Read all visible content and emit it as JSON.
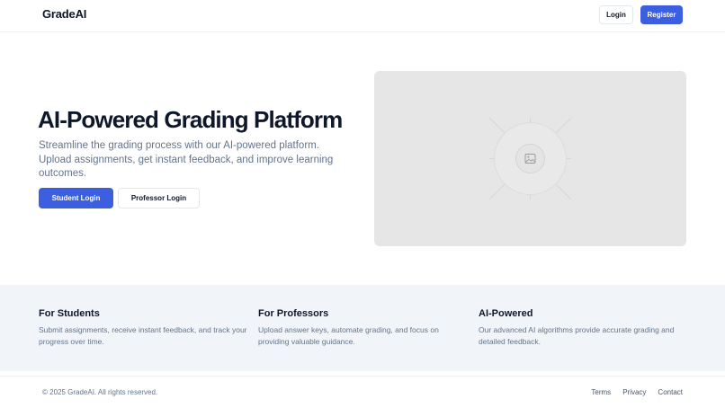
{
  "header": {
    "logo": "GradeAI",
    "login_label": "Login",
    "register_label": "Register"
  },
  "hero": {
    "title": "AI-Powered Grading Platform",
    "description": "Streamline the grading process with our AI-powered platform. Upload assignments, get instant feedback, and improve learning outcomes.",
    "student_login_label": "Student Login",
    "professor_login_label": "Professor Login",
    "image_icon": "image-placeholder-icon"
  },
  "features": [
    {
      "title": "For Students",
      "description": "Submit assignments, receive instant feedback, and track your progress over time."
    },
    {
      "title": "For Professors",
      "description": "Upload answer keys, automate grading, and focus on providing valuable guidance."
    },
    {
      "title": "AI-Powered",
      "description": "Our advanced AI algorithms provide accurate grading and detailed feedback."
    }
  ],
  "footer": {
    "copyright": "© 2025 GradeAI. All rights reserved.",
    "links": [
      "Terms",
      "Privacy",
      "Contact"
    ]
  },
  "colors": {
    "primary": "#3b5fe0",
    "text": "#0f172a",
    "muted": "#64748b",
    "feature_bg": "#f1f5f9",
    "placeholder_bg": "#e6e6e6"
  }
}
